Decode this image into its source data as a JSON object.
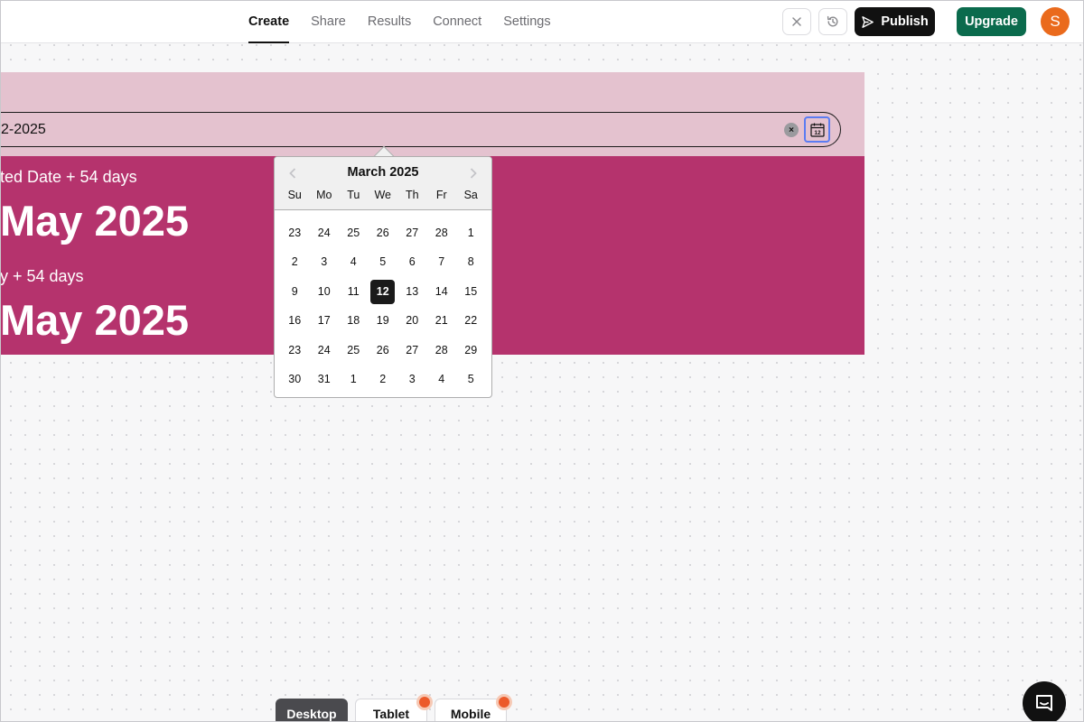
{
  "nav": {
    "tabs": [
      {
        "label": "Create",
        "active": true
      },
      {
        "label": "Share",
        "active": false
      },
      {
        "label": "Results",
        "active": false
      },
      {
        "label": "Connect",
        "active": false
      },
      {
        "label": "Settings",
        "active": false
      }
    ]
  },
  "toolbar": {
    "close_icon": "close-icon",
    "history_icon": "history-icon",
    "publish_label": "Publish",
    "publish_icon": "send-icon",
    "upgrade_label": "Upgrade",
    "avatar_initial": "S"
  },
  "form": {
    "date_value": "2-2025",
    "clear_icon": "clear-icon",
    "calendar_icon": "calendar-icon",
    "calendar_icon_number": "12",
    "result_1_label": "ted Date + 54 days",
    "result_1_value": "May 2025",
    "result_2_label": "y + 54 days",
    "result_2_value": "May 2025"
  },
  "datepicker": {
    "month_label": "March 2025",
    "prev_icon": "chevron-left-icon",
    "next_icon": "chevron-right-icon",
    "weekdays": [
      "Su",
      "Mo",
      "Tu",
      "We",
      "Th",
      "Fr",
      "Sa"
    ],
    "weeks": [
      [
        "23",
        "24",
        "25",
        "26",
        "27",
        "28",
        "1"
      ],
      [
        "2",
        "3",
        "4",
        "5",
        "6",
        "7",
        "8"
      ],
      [
        "9",
        "10",
        "11",
        "12",
        "13",
        "14",
        "15"
      ],
      [
        "16",
        "17",
        "18",
        "19",
        "20",
        "21",
        "22"
      ],
      [
        "23",
        "24",
        "25",
        "26",
        "27",
        "28",
        "29"
      ],
      [
        "30",
        "31",
        "1",
        "2",
        "3",
        "4",
        "5"
      ]
    ],
    "selected": "12"
  },
  "devices": {
    "desktop_label": "Desktop",
    "tablet_label": "Tablet",
    "mobile_label": "Mobile"
  },
  "chat": {
    "icon": "chat-icon"
  },
  "colors": {
    "form_background": "#e4c2cf",
    "results_background": "#b5336d",
    "publish": "#111111",
    "upgrade": "#0b6b4d",
    "avatar": "#ea6a1c",
    "calendar_focus": "#5b7cf2"
  }
}
